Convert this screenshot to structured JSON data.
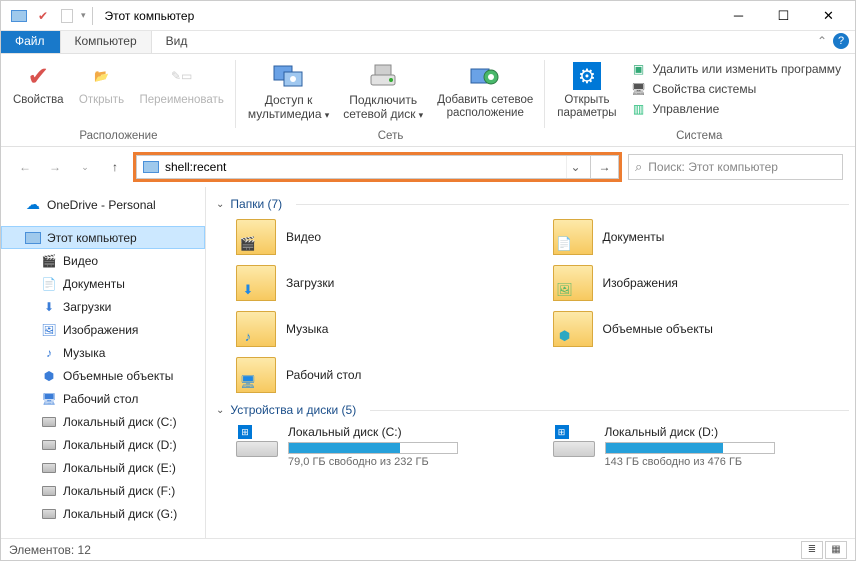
{
  "title": "Этот компьютер",
  "tabs": {
    "file": "Файл",
    "computer": "Компьютер",
    "view": "Вид"
  },
  "ribbon": {
    "location": {
      "label": "Расположение",
      "properties": "Свойства",
      "open": "Открыть",
      "rename": "Переименовать"
    },
    "network": {
      "label": "Сеть",
      "media": "Доступ к\nмультимедиа",
      "mapdrive": "Подключить\nсетевой диск",
      "addloc": "Добавить сетевое\nрасположение"
    },
    "system": {
      "label": "Система",
      "opensettings": "Открыть\nпараметры",
      "uninstall": "Удалить или изменить программу",
      "sysprops": "Свойства системы",
      "manage": "Управление"
    }
  },
  "address": {
    "value": "shell:recent"
  },
  "search": {
    "placeholder": "Поиск: Этот компьютер"
  },
  "sidebar": {
    "onedrive": "OneDrive - Personal",
    "thispc": "Этот компьютер",
    "items": [
      "Видео",
      "Документы",
      "Загрузки",
      "Изображения",
      "Музыка",
      "Объемные объекты",
      "Рабочий стол",
      "Локальный диск (C:)",
      "Локальный диск (D:)",
      "Локальный диск (E:)",
      "Локальный диск (F:)",
      "Локальный диск (G:)"
    ]
  },
  "sections": {
    "folders": "Папки (7)",
    "drives": "Устройства и диски (5)"
  },
  "folders": [
    {
      "name": "Видео",
      "badge": "🎬",
      "color": "#3b7dd8"
    },
    {
      "name": "Документы",
      "badge": "📄",
      "color": "#6aa2e6"
    },
    {
      "name": "Загрузки",
      "badge": "⬇",
      "color": "#1e88e5"
    },
    {
      "name": "Изображения",
      "badge": "🖼",
      "color": "#55b869"
    },
    {
      "name": "Музыка",
      "badge": "♪",
      "color": "#1e88e5"
    },
    {
      "name": "Объемные объекты",
      "badge": "⬢",
      "color": "#2ca8c2"
    },
    {
      "name": "Рабочий стол",
      "badge": "🖥",
      "color": "#1e88e5"
    }
  ],
  "drives": [
    {
      "name": "Локальный диск (C:)",
      "free": "79,0 ГБ свободно из 232 ГБ",
      "pct": 66
    },
    {
      "name": "Локальный диск (D:)",
      "free": "143 ГБ свободно из 476 ГБ",
      "pct": 70
    }
  ],
  "status": "Элементов: 12"
}
